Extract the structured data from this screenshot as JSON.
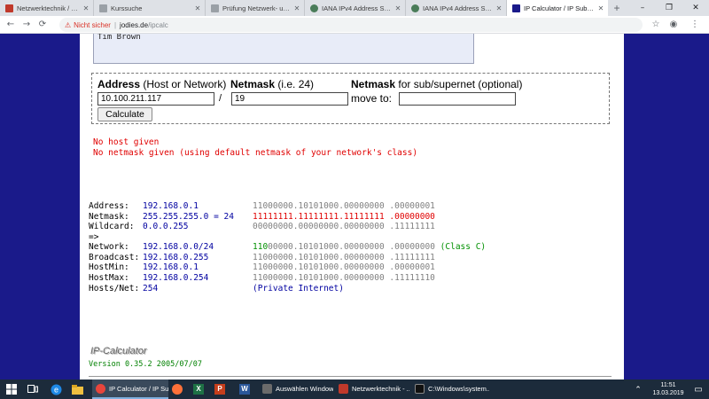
{
  "browser": {
    "tabs": [
      {
        "label": "Netzwerktechnik / VHS BS /",
        "color": "#c0392b"
      },
      {
        "label": "Kurssuche",
        "color": "#5f6368"
      },
      {
        "label": "Prüfung Netzwerk- und Inter",
        "color": "#5f6368"
      },
      {
        "label": "IANA IPv4 Address Space Re",
        "color": "#4a7c59"
      },
      {
        "label": "IANA IPv4 Address Space Re",
        "color": "#4a7c59"
      },
      {
        "label": "IP Calculator / IP Subnetting",
        "color": "#1a1a8a"
      }
    ],
    "new_tab": "+",
    "security_warning": "Nicht sicher",
    "url_host": "jodies.de",
    "url_path": "/ipcalc"
  },
  "page": {
    "textarea_text": "Tim Brown",
    "form": {
      "address_label_bold": "Address",
      "address_label_rest": "(Host or Network)",
      "netmask_label_bold": "Netmask",
      "netmask_label_rest": "(i.e. 24)",
      "netmask2_label_bold": "Netmask",
      "netmask2_label_rest": "for sub/supernet (optional)",
      "address_value": "10.100.211.117",
      "slash": "/",
      "netmask_value": "19",
      "move_to_label": "move to:",
      "move_to_value": "",
      "calculate_label": "Calculate"
    },
    "errors": [
      "No host given",
      "No netmask given (using default netmask of your network's class)"
    ],
    "results": {
      "address": {
        "key": "Address:",
        "value": "192.168.0.1",
        "bits": "11000000.10101000.00000000 .00000001"
      },
      "netmask": {
        "key": "Netmask:",
        "value": "255.255.255.0 = 24",
        "bits": "11111111.11111111.11111111 .00000000"
      },
      "wildcard": {
        "key": "Wildcard:",
        "value": "0.0.0.255",
        "bits": "00000000.00000000.00000000 .11111111"
      },
      "arrow": "=>",
      "network": {
        "key": "Network:",
        "value": "192.168.0.0/24",
        "bits_highlight": "110",
        "bits_rest": "00000.10101000.00000000 .00000000",
        "class_note": "(Class C)"
      },
      "broadcast": {
        "key": "Broadcast:",
        "value": "192.168.0.255",
        "bits": "11000000.10101000.00000000 .11111111"
      },
      "hostmin": {
        "key": "HostMin:",
        "value": "192.168.0.1",
        "bits": "11000000.10101000.00000000 .00000001"
      },
      "hostmax": {
        "key": "HostMax:",
        "value": "192.168.0.254",
        "bits": "11000000.10101000.00000000 .11111110"
      },
      "hosts": {
        "key": "Hosts/Net:",
        "value": "254",
        "note": "(Private Internet)"
      }
    },
    "logo_text": "IP-Calculator",
    "version": "Version 0.35.2 2005/07/07"
  },
  "taskbar": {
    "apps": [
      {
        "label": "IP Calculator / IP Su...",
        "active": true,
        "color": "#e8453c"
      },
      {
        "label": "Auswählen Window...",
        "active": false,
        "color": "#6b6b6b"
      },
      {
        "label": "Netzwerktechnik - ...",
        "active": false,
        "color": "#c0392b"
      },
      {
        "label": "C:\\Windows\\system...",
        "active": false,
        "color": "#222222"
      }
    ],
    "pinned": [
      {
        "name": "firefox",
        "label": "",
        "color": "#ff7139"
      },
      {
        "name": "excel",
        "label": "X",
        "color": "#1e7145"
      },
      {
        "name": "powerpoint",
        "label": "P",
        "color": "#c43e1c"
      },
      {
        "name": "word",
        "label": "W",
        "color": "#2b579a"
      }
    ],
    "time": "11:51",
    "date": "13.03.2019"
  },
  "colors": {
    "page_background": "#1a1a8a",
    "value_blue": "#0000a0",
    "error_red": "#e00000",
    "class_green": "#009000"
  }
}
